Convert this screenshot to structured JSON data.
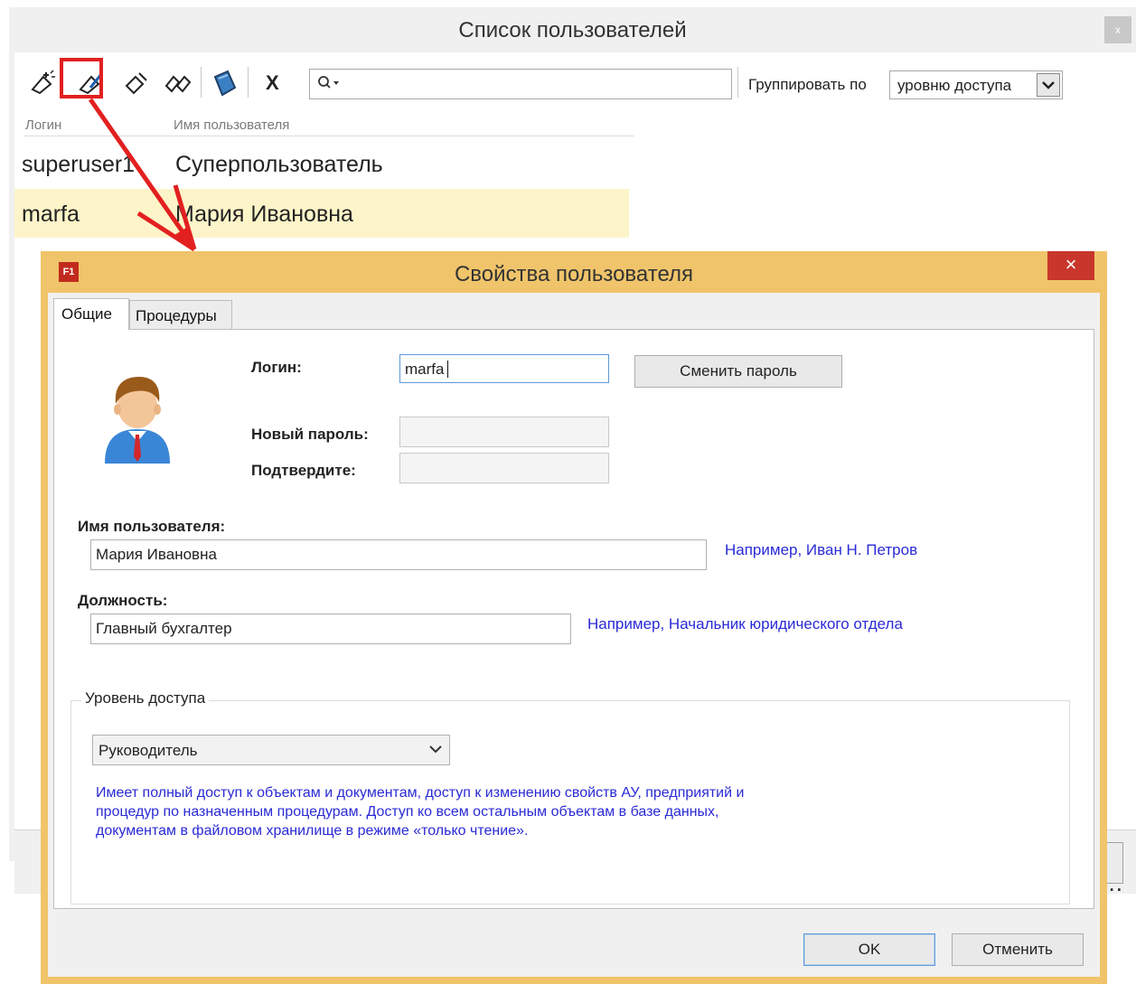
{
  "list_window": {
    "title": "Список пользователей",
    "close_glyph": "x",
    "toolbar": {
      "buttons": [
        {
          "icon": "add-user-icon"
        },
        {
          "icon": "edit-user-icon"
        },
        {
          "icon": "delete-user-icon"
        },
        {
          "icon": "copy-user-icon"
        },
        {
          "icon": "book-icon"
        }
      ],
      "clear_glyph": "X",
      "search_placeholder": "",
      "group_by_label": "Группировать по",
      "group_by_value": "уровню доступа"
    },
    "columns": [
      "Логин",
      "Имя пользователя"
    ],
    "users": [
      {
        "login": "superuser1",
        "name": "Суперпользователь",
        "selected": false
      },
      {
        "login": "marfa",
        "name": "Мария Ивановна",
        "selected": true
      }
    ],
    "ellipsis": "..."
  },
  "dialog": {
    "app_icon": "F1",
    "title": "Свойства пользователя",
    "close_glyph": "×",
    "tabs": [
      {
        "label": "Общие",
        "active": true
      },
      {
        "label": "Процедуры",
        "active": false
      }
    ],
    "login_label": "Логин:",
    "login_value": "marfa",
    "change_password_label": "Сменить пароль",
    "new_password_label": "Новый пароль:",
    "confirm_label": "Подтвердите:",
    "username_label": "Имя пользователя:",
    "username_value": "Мария Ивановна",
    "username_hint": "Например, Иван Н. Петров",
    "position_label": "Должность:",
    "position_value": "Главный бухгалтер",
    "position_hint": "Например, Начальник юридического отдела",
    "access_group_label": "Уровень доступа",
    "access_level": "Руководитель",
    "access_description_lines": [
      "Имеет полный доступ к объектам и документам, доступ к изменению свойств АУ, предприятий и",
      "процедур по назначенным процедурам. Доступ ко всем остальным объектам в базе данных,",
      "документам в файловом хранилище в режиме «только чтение»."
    ],
    "ok_label": "OK",
    "cancel_label": "Отменить"
  },
  "colors": {
    "dialog_frame": "#f0c46a",
    "selected_row": "#fdf5c9",
    "hint_text": "#2a2ad6",
    "close_button": "#c9372c",
    "annotation": "#e22020"
  }
}
